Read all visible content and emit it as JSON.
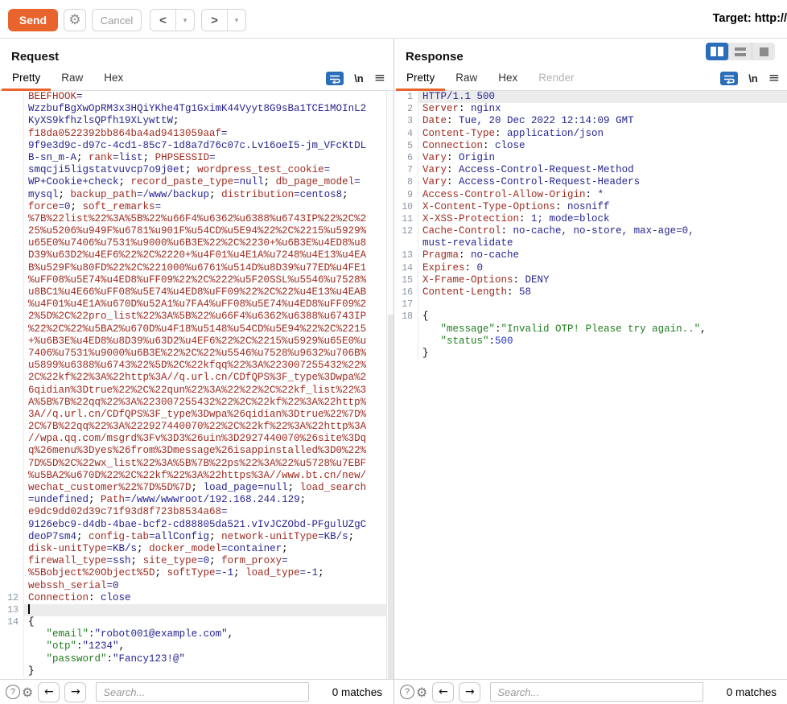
{
  "toolbar": {
    "send": "Send",
    "cancel": "Cancel",
    "back": "<",
    "forward": ">",
    "dropdown": "▾",
    "target": "Target: http://"
  },
  "icons": {
    "gear": "⚙",
    "help": "?",
    "left_arrow": "←",
    "right_arrow": "→",
    "newline": "\\n",
    "hamburger": "≡"
  },
  "request": {
    "title": "Request",
    "tabs": [
      "Pretty",
      "Raw",
      "Hex"
    ],
    "active_tab": "Pretty",
    "search_placeholder": "Search...",
    "matches": "0 matches",
    "rows": [
      {
        "segs": [
          [
            "n",
            "BEEFHOOK"
          ],
          [
            "v",
            "="
          ]
        ]
      },
      {
        "segs": [
          [
            "v",
            "WzzbufBgXwOpRM3x3HQiYKhe4Tg1GximK44Vyyt8G9sBa1TCE1MOInL2"
          ]
        ]
      },
      {
        "segs": [
          [
            "v",
            "KyXS9kfhzlsQPfh19XLywttW"
          ],
          [
            "p",
            ";"
          ]
        ]
      },
      {
        "segs": [
          [
            "n",
            "f18da0522392bb864ba4ad9413059aaf"
          ],
          [
            "v",
            "="
          ]
        ]
      },
      {
        "segs": [
          [
            "v",
            "9f9e3d9c-d97c-4cd1-85c7-1d8a7d76c07c.Lv16oeI5-jm_VFcKtDL"
          ]
        ]
      },
      {
        "segs": [
          [
            "v",
            "B-sn_m-A"
          ],
          [
            "p",
            "; "
          ],
          [
            "n",
            "rank"
          ],
          [
            "v",
            "=list"
          ],
          [
            "p",
            "; "
          ],
          [
            "n",
            "PHPSESSID"
          ],
          [
            "v",
            "="
          ]
        ]
      },
      {
        "segs": [
          [
            "v",
            "smqcji5ligstatvuvcp7o9j0et"
          ],
          [
            "p",
            "; "
          ],
          [
            "n",
            "wordpress_test_cookie"
          ],
          [
            "v",
            "="
          ]
        ]
      },
      {
        "segs": [
          [
            "v",
            "WP+Cookie+check"
          ],
          [
            "p",
            "; "
          ],
          [
            "n",
            "record_paste_type"
          ],
          [
            "v",
            "=null"
          ],
          [
            "p",
            "; "
          ],
          [
            "n",
            "db_page_model"
          ],
          [
            "v",
            "="
          ]
        ]
      },
      {
        "segs": [
          [
            "v",
            "mysql"
          ],
          [
            "p",
            "; "
          ],
          [
            "n",
            "backup_path"
          ],
          [
            "v",
            "=/www/backup"
          ],
          [
            "p",
            "; "
          ],
          [
            "n",
            "distribution"
          ],
          [
            "v",
            "=centos8"
          ],
          [
            "p",
            ";"
          ]
        ]
      },
      {
        "segs": [
          [
            "n",
            "force"
          ],
          [
            "v",
            "=0"
          ],
          [
            "p",
            "; "
          ],
          [
            "n",
            "soft_remarks"
          ],
          [
            "v",
            "="
          ]
        ]
      },
      {
        "segs": [
          [
            "n",
            "%7B%22list%22%3A%5B%22%u66F4%u6362%u6388%u6743IP%22%2C%2"
          ]
        ]
      },
      {
        "segs": [
          [
            "n",
            "25%u5206%u949F%u6781%u901F%u54CD%u5E94%22%2C%2215%u5929%"
          ]
        ]
      },
      {
        "segs": [
          [
            "n",
            "u65E0%u7406%u7531%u9000%u6B3E%22%2C%2230+%u6B3E%u4ED8%u8"
          ]
        ]
      },
      {
        "segs": [
          [
            "n",
            "D39%u63D2%u4EF6%22%2C%2220+%u4F01%u4E1A%u7248%u4E13%u4EA"
          ]
        ]
      },
      {
        "segs": [
          [
            "n",
            "B%u529F%u80FD%22%2C%221000%u6761%u514D%u8D39%u77ED%u4FE1"
          ]
        ]
      },
      {
        "segs": [
          [
            "n",
            "%uFF08%u5E74%u4ED8%uFF09%22%2C%222%u5F20SSL%u5546%u7528%"
          ]
        ]
      },
      {
        "segs": [
          [
            "n",
            "u8BC1%u4E66%uFF08%u5E74%u4ED8%uFF09%22%2C%22%u4E13%u4EAB"
          ]
        ]
      },
      {
        "segs": [
          [
            "n",
            "%u4F01%u4E1A%u670D%u52A1%u7FA4%uFF08%u5E74%u4ED8%uFF09%2"
          ]
        ]
      },
      {
        "segs": [
          [
            "n",
            "2%5D%2C%22pro_list%22%3A%5B%22%u66F4%u6362%u6388%u6743IP"
          ]
        ]
      },
      {
        "segs": [
          [
            "n",
            "%22%2C%22%u5BA2%u670D%u4F18%u5148%u54CD%u5E94%22%2C%2215"
          ]
        ]
      },
      {
        "segs": [
          [
            "n",
            "+%u6B3E%u4ED8%u8D39%u63D2%u4EF6%22%2C%2215%u5929%u65E0%u"
          ]
        ]
      },
      {
        "segs": [
          [
            "n",
            "7406%u7531%u9000%u6B3E%22%2C%22%u5546%u7528%u9632%u706B%"
          ]
        ]
      },
      {
        "segs": [
          [
            "n",
            "u5899%u6388%u6743%22%5D%2C%22kfqq%22%3A%223007255432%22%"
          ]
        ]
      },
      {
        "segs": [
          [
            "n",
            "2C%22kf%22%3A%22http%3A//q.url.cn/CDfQPS%3F_type%3Dwpa%2"
          ]
        ]
      },
      {
        "segs": [
          [
            "n",
            "6qidian%3Dtrue%22%2C%22qun%22%3A%22%22%2C%22kf_list%22%3"
          ]
        ]
      },
      {
        "segs": [
          [
            "n",
            "A%5B%7B%22qq%22%3A%223007255432%22%2C%22kf%22%3A%22http%"
          ]
        ]
      },
      {
        "segs": [
          [
            "n",
            "3A//q.url.cn/CDfQPS%3F_type%3Dwpa%26qidian%3Dtrue%22%7D%"
          ]
        ]
      },
      {
        "segs": [
          [
            "n",
            "2C%7B%22qq%22%3A%222927440070%22%2C%22kf%22%3A%22http%3A"
          ]
        ]
      },
      {
        "segs": [
          [
            "n",
            "//wpa.qq.com/msgrd%3Fv%3D3%26uin%3D2927440070%26site%3Dq"
          ]
        ]
      },
      {
        "segs": [
          [
            "n",
            "q%26menu%3Dyes%26from%3Dmessage%26isappinstalled%3D0%22%"
          ]
        ]
      },
      {
        "segs": [
          [
            "n",
            "7D%5D%2C%22wx_list%22%3A%5B%7B%22ps%22%3A%22%u5728%u7EBF"
          ]
        ]
      },
      {
        "segs": [
          [
            "n",
            "%u5BA2%u670D%22%2C%22kf%22%3A%22https%3A//www.bt.cn/new/"
          ]
        ]
      },
      {
        "segs": [
          [
            "n",
            "wechat_customer%22%7D%5D%7D"
          ],
          [
            "p",
            "; "
          ],
          [
            "v",
            "load_page=null"
          ],
          [
            "p",
            "; "
          ],
          [
            "n",
            "load_search"
          ]
        ]
      },
      {
        "segs": [
          [
            "v",
            "=undefined"
          ],
          [
            "p",
            "; "
          ],
          [
            "n",
            "Path"
          ],
          [
            "v",
            "=/www/wwwroot/192.168.244.129"
          ],
          [
            "p",
            ";"
          ]
        ]
      },
      {
        "segs": [
          [
            "n",
            "e9dc9dd02d39c71f93d8f723b8534a68"
          ],
          [
            "v",
            "="
          ]
        ]
      },
      {
        "segs": [
          [
            "v",
            "9126ebc9-d4db-4bae-bcf2-cd88805da521.vIvJCZObd-PFgulUZgC"
          ]
        ]
      },
      {
        "segs": [
          [
            "v",
            "deoP7sm4"
          ],
          [
            "p",
            "; "
          ],
          [
            "n",
            "config-tab"
          ],
          [
            "v",
            "=allConfig"
          ],
          [
            "p",
            "; "
          ],
          [
            "n",
            "network-unitType"
          ],
          [
            "v",
            "=KB/s"
          ],
          [
            "p",
            ";"
          ]
        ]
      },
      {
        "segs": [
          [
            "n",
            "disk-unitType"
          ],
          [
            "v",
            "=KB/s"
          ],
          [
            "p",
            "; "
          ],
          [
            "n",
            "docker_model"
          ],
          [
            "v",
            "=container"
          ],
          [
            "p",
            ";"
          ]
        ]
      },
      {
        "segs": [
          [
            "n",
            "firewall_type"
          ],
          [
            "v",
            "=ssh"
          ],
          [
            "p",
            "; "
          ],
          [
            "n",
            "site_type"
          ],
          [
            "v",
            "=0"
          ],
          [
            "p",
            "; "
          ],
          [
            "n",
            "form_proxy"
          ],
          [
            "v",
            "="
          ]
        ]
      },
      {
        "segs": [
          [
            "n",
            "%5Bobject%20Object%5D"
          ],
          [
            "p",
            "; "
          ],
          [
            "n",
            "softType"
          ],
          [
            "v",
            "=-1"
          ],
          [
            "p",
            "; "
          ],
          [
            "n",
            "load_type"
          ],
          [
            "v",
            "=-1"
          ],
          [
            "p",
            ";"
          ]
        ]
      },
      {
        "segs": [
          [
            "n",
            "webssh_serial"
          ],
          [
            "v",
            "=0"
          ]
        ]
      },
      {
        "num": "12",
        "segs": [
          [
            "n",
            "Connection"
          ],
          [
            "p",
            ": "
          ],
          [
            "v",
            "close"
          ]
        ]
      },
      {
        "num": "13",
        "hl": true,
        "caret": true,
        "segs": []
      },
      {
        "num": "14",
        "segs": [
          [
            "p",
            "{"
          ]
        ]
      },
      {
        "segs": [
          [
            "p",
            "   "
          ],
          [
            "k",
            "\"email\""
          ],
          [
            "p",
            ":"
          ],
          [
            "v",
            "\"robot001@example.com\""
          ],
          [
            "p",
            ","
          ]
        ]
      },
      {
        "segs": [
          [
            "p",
            "   "
          ],
          [
            "k",
            "\"otp\""
          ],
          [
            "p",
            ":"
          ],
          [
            "v",
            "\"1234\""
          ],
          [
            "p",
            ","
          ]
        ]
      },
      {
        "segs": [
          [
            "p",
            "   "
          ],
          [
            "k",
            "\"password\""
          ],
          [
            "p",
            ":"
          ],
          [
            "v",
            "\"Fancy123!@\""
          ]
        ]
      },
      {
        "segs": [
          [
            "p",
            "}"
          ]
        ]
      }
    ],
    "scrollbar": {
      "thumb_top_pct": 38,
      "thumb_height_pct": 62
    }
  },
  "response": {
    "title": "Response",
    "tabs": [
      "Pretty",
      "Raw",
      "Hex",
      "Render"
    ],
    "active_tab": "Pretty",
    "disabled_tabs": [
      "Render"
    ],
    "search_placeholder": "Search...",
    "matches": "0 matches",
    "rows": [
      {
        "num": "1",
        "hl": true,
        "segs": [
          [
            "v",
            "HTTP/1.1 500"
          ]
        ]
      },
      {
        "num": "2",
        "segs": [
          [
            "n",
            "Server"
          ],
          [
            "p",
            ": "
          ],
          [
            "v",
            "nginx"
          ]
        ]
      },
      {
        "num": "3",
        "segs": [
          [
            "n",
            "Date"
          ],
          [
            "p",
            ": "
          ],
          [
            "v",
            "Tue, 20 Dec 2022 12:14:09 GMT"
          ]
        ]
      },
      {
        "num": "4",
        "segs": [
          [
            "n",
            "Content-Type"
          ],
          [
            "p",
            ": "
          ],
          [
            "v",
            "application/json"
          ]
        ]
      },
      {
        "num": "5",
        "segs": [
          [
            "n",
            "Connection"
          ],
          [
            "p",
            ": "
          ],
          [
            "v",
            "close"
          ]
        ]
      },
      {
        "num": "6",
        "segs": [
          [
            "n",
            "Vary"
          ],
          [
            "p",
            ": "
          ],
          [
            "v",
            "Origin"
          ]
        ]
      },
      {
        "num": "7",
        "segs": [
          [
            "n",
            "Vary"
          ],
          [
            "p",
            ": "
          ],
          [
            "v",
            "Access-Control-Request-Method"
          ]
        ]
      },
      {
        "num": "8",
        "segs": [
          [
            "n",
            "Vary"
          ],
          [
            "p",
            ": "
          ],
          [
            "v",
            "Access-Control-Request-Headers"
          ]
        ]
      },
      {
        "num": "9",
        "segs": [
          [
            "n",
            "Access-Control-Allow-Origin"
          ],
          [
            "p",
            ": "
          ],
          [
            "v",
            "*"
          ]
        ]
      },
      {
        "num": "10",
        "segs": [
          [
            "n",
            "X-Content-Type-Options"
          ],
          [
            "p",
            ": "
          ],
          [
            "v",
            "nosniff"
          ]
        ]
      },
      {
        "num": "11",
        "segs": [
          [
            "n",
            "X-XSS-Protection"
          ],
          [
            "p",
            ": "
          ],
          [
            "v",
            "1; mode=block"
          ]
        ]
      },
      {
        "num": "12",
        "segs": [
          [
            "n",
            "Cache-Control"
          ],
          [
            "p",
            ": "
          ],
          [
            "v",
            "no-cache, no-store, max-age=0,"
          ]
        ]
      },
      {
        "segs": [
          [
            "v",
            "must-revalidate"
          ]
        ]
      },
      {
        "num": "13",
        "segs": [
          [
            "n",
            "Pragma"
          ],
          [
            "p",
            ": "
          ],
          [
            "v",
            "no-cache"
          ]
        ]
      },
      {
        "num": "14",
        "segs": [
          [
            "n",
            "Expires"
          ],
          [
            "p",
            ": "
          ],
          [
            "v",
            "0"
          ]
        ]
      },
      {
        "num": "15",
        "segs": [
          [
            "n",
            "X-Frame-Options"
          ],
          [
            "p",
            ": "
          ],
          [
            "v",
            "DENY"
          ]
        ]
      },
      {
        "num": "16",
        "segs": [
          [
            "n",
            "Content-Length"
          ],
          [
            "p",
            ": "
          ],
          [
            "v",
            "58"
          ]
        ]
      },
      {
        "num": "17",
        "segs": []
      },
      {
        "num": "18",
        "segs": [
          [
            "p",
            "{"
          ]
        ]
      },
      {
        "segs": [
          [
            "p",
            "   "
          ],
          [
            "k",
            "\"message\""
          ],
          [
            "p",
            ":"
          ],
          [
            "s",
            "\"Invalid OTP! Please try again..\""
          ],
          [
            "p",
            ","
          ]
        ]
      },
      {
        "segs": [
          [
            "p",
            "   "
          ],
          [
            "k",
            "\"status\""
          ],
          [
            "p",
            ":"
          ],
          [
            "b",
            "500"
          ]
        ]
      },
      {
        "segs": [
          [
            "p",
            "}"
          ]
        ]
      }
    ]
  },
  "colors": {
    "accent_orange": "#e8642c",
    "accent_blue": "#2a6db8",
    "header_name": "#9e2b20",
    "header_value": "#26268f",
    "json_key_green": "#1e7d1e",
    "number_blue": "#2533c0"
  }
}
